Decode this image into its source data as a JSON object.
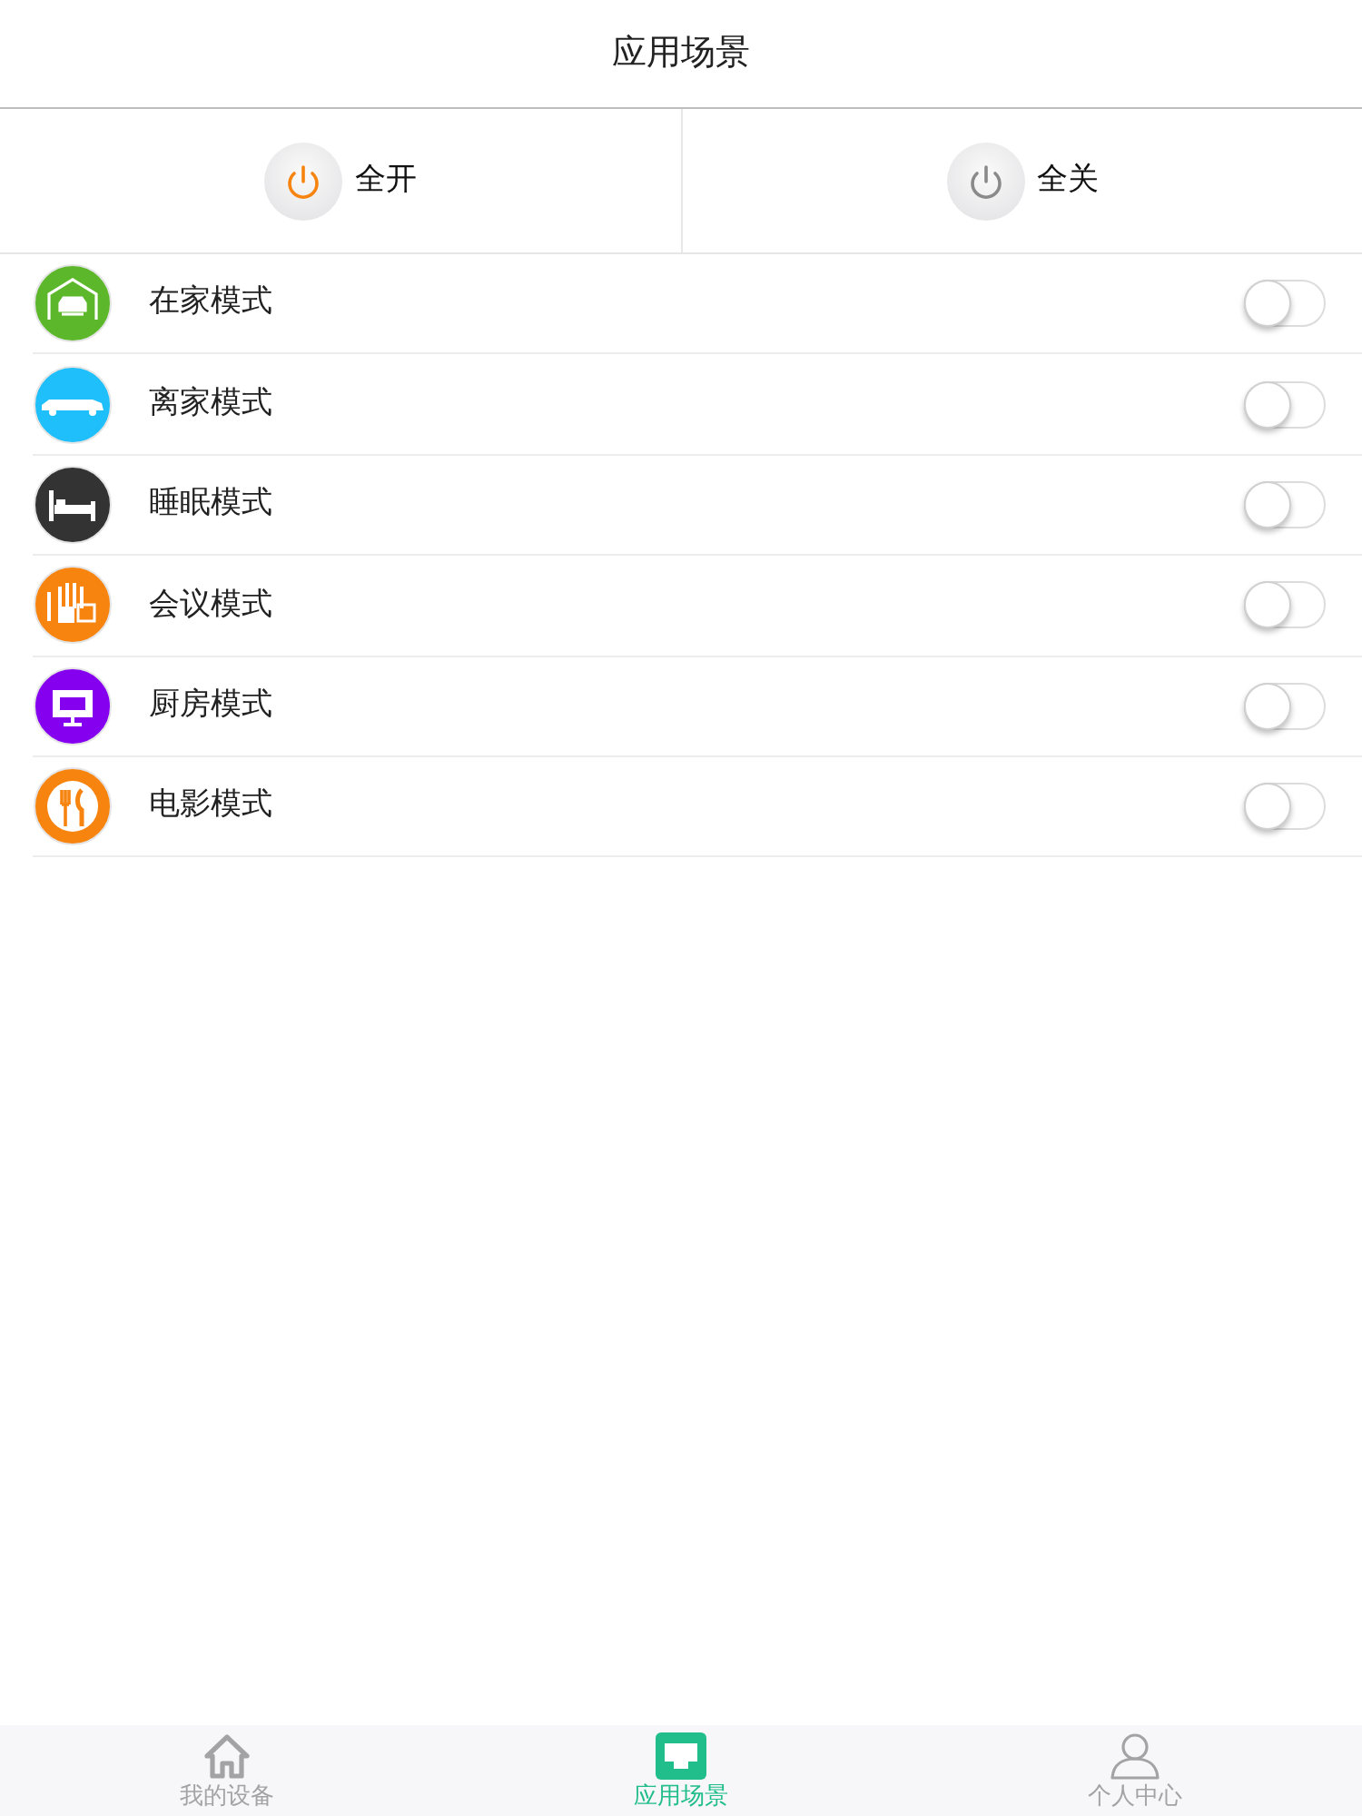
{
  "header": {
    "title": "应用场景"
  },
  "quick_actions": [
    {
      "label": "全开",
      "kind": "on"
    },
    {
      "label": "全关",
      "kind": "off"
    }
  ],
  "scenes": [
    {
      "name": "在家模式",
      "kind": "garage",
      "color": "#5cb82a",
      "on": false
    },
    {
      "name": "离家模式",
      "kind": "limousine",
      "color": "#1ebffa",
      "on": false
    },
    {
      "name": "睡眠模式",
      "kind": "bed",
      "color": "#333333",
      "on": false
    },
    {
      "name": "会议模式",
      "kind": "building",
      "color": "#f7840f",
      "on": false
    },
    {
      "name": "厨房模式",
      "kind": "monitor",
      "color": "#8600f0",
      "on": false
    },
    {
      "name": "电影模式",
      "kind": "cutlery",
      "color": "#f7840f",
      "on": false
    }
  ],
  "tab_bar": [
    {
      "label": "我的设备",
      "kind": "home",
      "selected": false
    },
    {
      "label": "应用场景",
      "kind": "scene",
      "selected": true
    },
    {
      "label": "个人中心",
      "kind": "person",
      "selected": false
    }
  ]
}
